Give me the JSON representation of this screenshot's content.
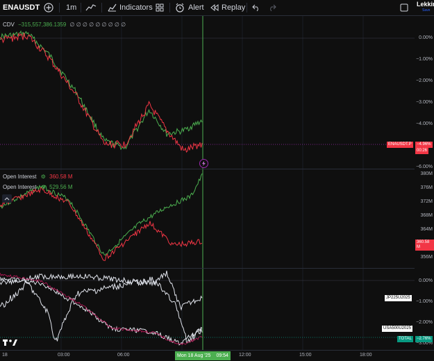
{
  "toolbar": {
    "symbol": "ENAUSDT",
    "interval": "1m",
    "indicators_label": "Indicators",
    "alert_label": "Alert",
    "replay_label": "Replay",
    "user_name": "Lekkin",
    "user_sub": "Save"
  },
  "pane1": {
    "title": "CDV",
    "value": "−315,557,386.1359",
    "placeholders": "∅ ∅ ∅ ∅ ∅ ∅ ∅ ∅ ∅",
    "ticks": [
      "0.00%",
      "−1.00%",
      "−2.00%",
      "−3.00%",
      "−4.00%",
      "−6.00%"
    ],
    "symbol_tag": "ENAUSDT.P",
    "price_tag": "−4.96%",
    "countdown_tag": "00:26"
  },
  "pane2": {
    "oi1_label": "Open Interest",
    "oi1_value": "360.58 M",
    "oi2_label": "Open Interest",
    "oi2_value": "529.56 M",
    "ticks": [
      "380M",
      "376M",
      "372M",
      "368M",
      "364M",
      "356M"
    ],
    "value_tag": "360.58 M"
  },
  "pane3": {
    "ticks": [
      "0.00%",
      "−1.00%",
      "−2.00%",
      "−3.00%"
    ],
    "jp_tag": "JP225U2025",
    "us_tag": "USA500U2025",
    "total_tag": "TOTAL",
    "total_value": "−2.76%"
  },
  "time_axis": {
    "labels": [
      "18",
      "03:00",
      "06:00",
      "12:00",
      "15:00",
      "18:00"
    ],
    "cursor_date": "Mon 18 Aug '25",
    "cursor_time": "09:54"
  },
  "colors": {
    "green": "#4caf50",
    "red": "#f23645",
    "cursor": "#4caf50",
    "tag_red": "#f23645",
    "tag_teal": "#089981",
    "white": "#e0e3eb"
  }
}
